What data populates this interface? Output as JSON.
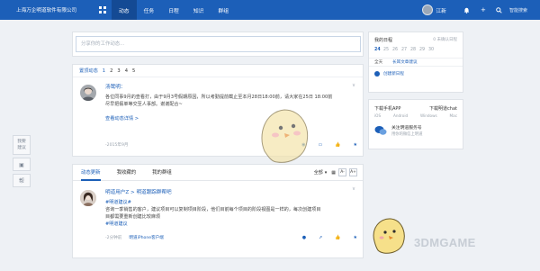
{
  "topbar": {
    "company": "上海万企明道软件有限公司",
    "tabs": [
      {
        "label": "动态",
        "active": true
      },
      {
        "label": "任务"
      },
      {
        "label": "日程"
      },
      {
        "label": "知识"
      },
      {
        "label": "群组"
      }
    ],
    "user_name": "江新",
    "search_label": "智能搜索"
  },
  "side_tools": {
    "feedback": "我要\n建议",
    "tool2": "▣",
    "tool3": "帮"
  },
  "post_box": {
    "placeholder": "分享你的工作动态..."
  },
  "top_feed": {
    "title": "置顶动态",
    "pages": [
      "1",
      "2",
      "3",
      "4",
      "5"
    ],
    "post": {
      "author": "汤鹭明：",
      "text_line1": "各位同事9月的查看打，由于9月3号假期原因，所以考勤提前截止至本月28日18:00前，请大家在25日 18:00前",
      "text_line2": "尽早把假单等交至人事部。谢谢配合~",
      "link": "查看动态详情 >",
      "time": "-2015年9月"
    }
  },
  "main_feed": {
    "tabs": [
      {
        "label": "动态更新",
        "active": true
      },
      {
        "label": "我收藏的"
      },
      {
        "label": "我的群组"
      }
    ],
    "filter_label": "全部",
    "post": {
      "author": "明道用户Z > 明道跟踪群帮吧",
      "tag": "#明道建议#",
      "text_line1": "咨询一季销售的客户，建议项目可以复制项目阶段，他们目前每个项目的阶段视图是一样的，每次创建项目",
      "text_line2": "目都需要重新创建比较麻烦",
      "text_line3": "#明道建议",
      "time": "-2分钟前",
      "source": "明道iPhone客户端"
    }
  },
  "schedule": {
    "title": "我的日程",
    "pending": "0 未确认日程",
    "days": [
      "24",
      "25",
      "26",
      "27",
      "28",
      "29",
      "30"
    ],
    "allday": "全天",
    "event": "长耳文章建议",
    "new": "创建新日程"
  },
  "download": {
    "mobile": "下载手机APP",
    "chat": "下载明道chat",
    "ios": "iOS",
    "android": "Android",
    "windows": "Windows",
    "mac": "Mac",
    "wechat_title": "关注明道服务号",
    "wechat_sub": "用你的微信上明道"
  },
  "watermark": "3DMGAME"
}
